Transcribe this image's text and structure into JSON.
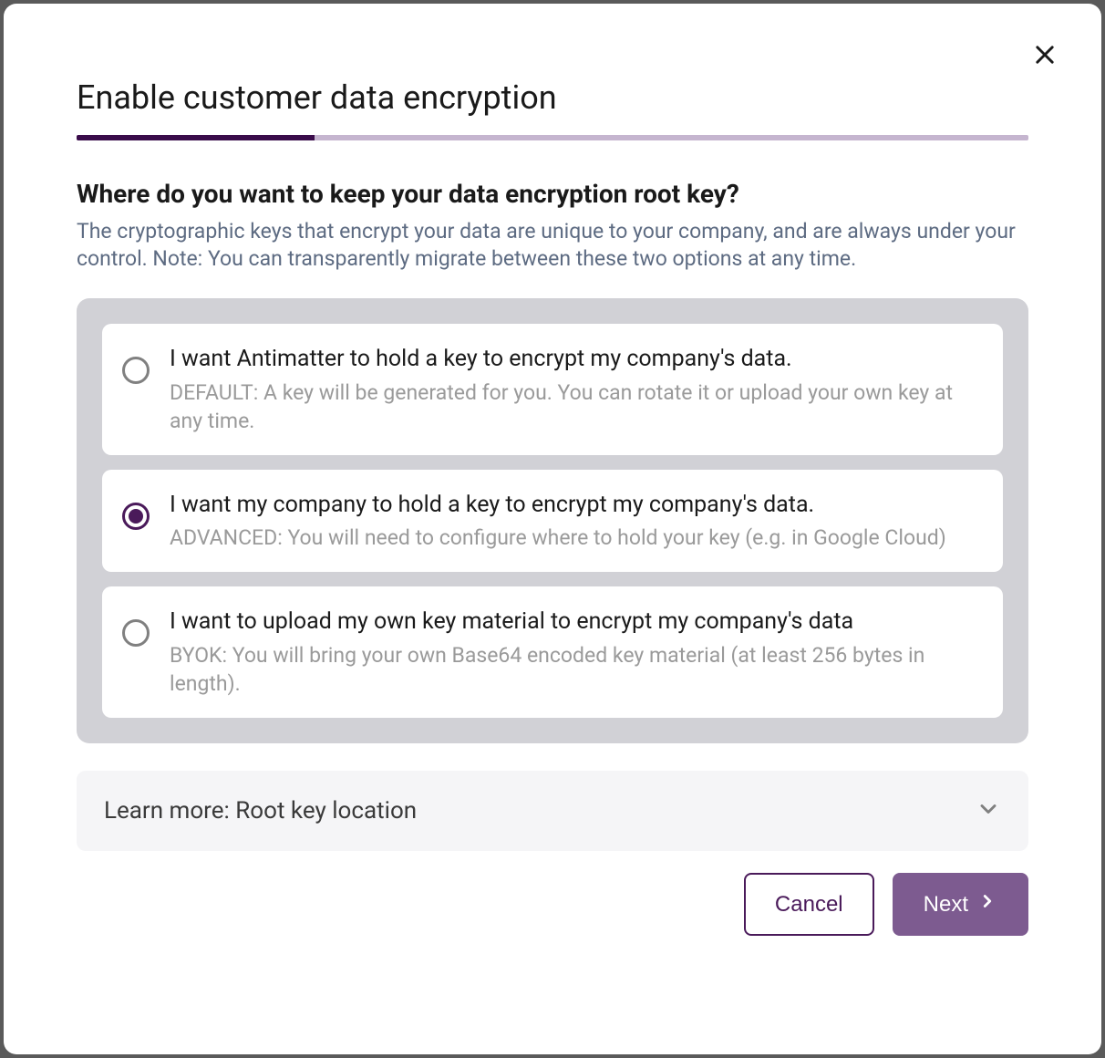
{
  "modal": {
    "title": "Enable customer data encryption",
    "progress_percent": 25
  },
  "question": {
    "title": "Where do you want to keep your data encryption root key?",
    "subtitle": "The cryptographic keys that encrypt your data are unique to your company, and are always under your control. Note: You can transparently migrate between these two options at any time."
  },
  "options": [
    {
      "title": "I want Antimatter to hold a key to encrypt my company's data.",
      "description": "DEFAULT: A key will be generated for you. You can rotate it or upload your own key at any time.",
      "selected": false
    },
    {
      "title": "I want my company to hold a key to encrypt my company's data.",
      "description": "ADVANCED: You will need to configure where to hold your key (e.g. in Google Cloud)",
      "selected": true
    },
    {
      "title": "I want to upload my own key material to encrypt my company's data",
      "description": "BYOK: You will bring your own Base64 encoded key material (at least 256 bytes in length).",
      "selected": false
    }
  ],
  "learn_more": {
    "label": "Learn more: Root key location"
  },
  "buttons": {
    "cancel": "Cancel",
    "next": "Next"
  }
}
